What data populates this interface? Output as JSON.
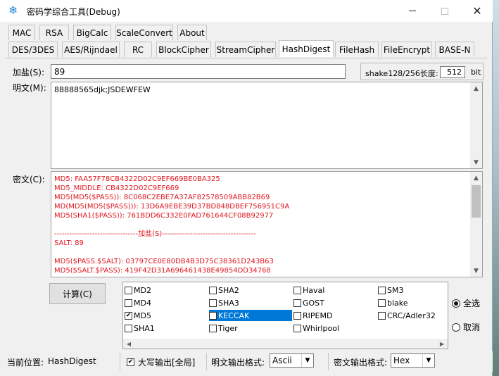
{
  "window": {
    "title": "密码学综合工具(Debug)"
  },
  "tabs_row1": [
    "MAC",
    "RSA",
    "BigCalc",
    "ScaleConvert",
    "About"
  ],
  "tabs_row2": [
    "DES/3DES",
    "AES/Rijndael",
    "RC",
    "BlockCipher",
    "StreamCipher",
    "HashDigest",
    "FileHash",
    "FileEncrypt",
    "BASE-N"
  ],
  "active_tab": "HashDigest",
  "salt": {
    "label": "加盐(S):",
    "value": "89"
  },
  "shake": {
    "label": "shake128/256长度:",
    "value": "512",
    "unit": "bit"
  },
  "plaintext": {
    "label": "明文(M):",
    "value": "88888565djk;JSDEWFEW"
  },
  "ciphertext": {
    "label": "密文(C):",
    "lines": [
      "MD5: FAA57F78CB4322D02C9EF669BE0BA325",
      "MD5_MIDDLE: CB4322D02C9EF669",
      "MD5(MD5($PASS)): 8C068C2EBE7A37AF82578509ABB82B69",
      "MD(MD5(MD5($PASS))): 13D6A9EBE39D37BD848DBEF756951C9A",
      "MD5(SHA1($PASS)): 761BDD6C332E0FAD761644CF08B92977",
      "",
      "---------------------------------加盐(S)-------------------------------------",
      "SALT: 89",
      "",
      "MD5($PASS.$SALT): 03797CE0E80DB4B3D75C38361D243B63",
      "MD5($SALT.$PASS): 419F42D31A696461438E49854DD34768"
    ]
  },
  "compute_button": "计算(C)",
  "algorithms": [
    {
      "label": "MD2",
      "checked": false
    },
    {
      "label": "SHA2",
      "checked": false
    },
    {
      "label": "Haval",
      "checked": false
    },
    {
      "label": "SM3",
      "checked": false
    },
    {
      "label": "MD4",
      "checked": false
    },
    {
      "label": "SHA3",
      "checked": false
    },
    {
      "label": "GOST",
      "checked": false
    },
    {
      "label": "blake",
      "checked": false
    },
    {
      "label": "MD5",
      "checked": true
    },
    {
      "label": "KECCAK",
      "checked": false,
      "selected": true
    },
    {
      "label": "RIPEMD",
      "checked": false
    },
    {
      "label": "CRC/Adler32",
      "checked": false
    },
    {
      "label": "SHA1",
      "checked": false
    },
    {
      "label": "Tiger",
      "checked": false
    },
    {
      "label": "Whirlpool",
      "checked": false
    }
  ],
  "select_all": {
    "label": "全选",
    "checked": true
  },
  "deselect": {
    "label": "取消",
    "checked": false
  },
  "status": {
    "location_label": "当前位置:",
    "location_value": "HashDigest",
    "uppercase_label": "大写输出[全局]",
    "uppercase_checked": true,
    "plain_format_label": "明文输出格式:",
    "plain_format_value": "Ascii",
    "cipher_format_label": "密文输出格式:",
    "cipher_format_value": "Hex"
  },
  "colors": {
    "cipher_text": "#e0161e",
    "selection": "#0078d7"
  }
}
